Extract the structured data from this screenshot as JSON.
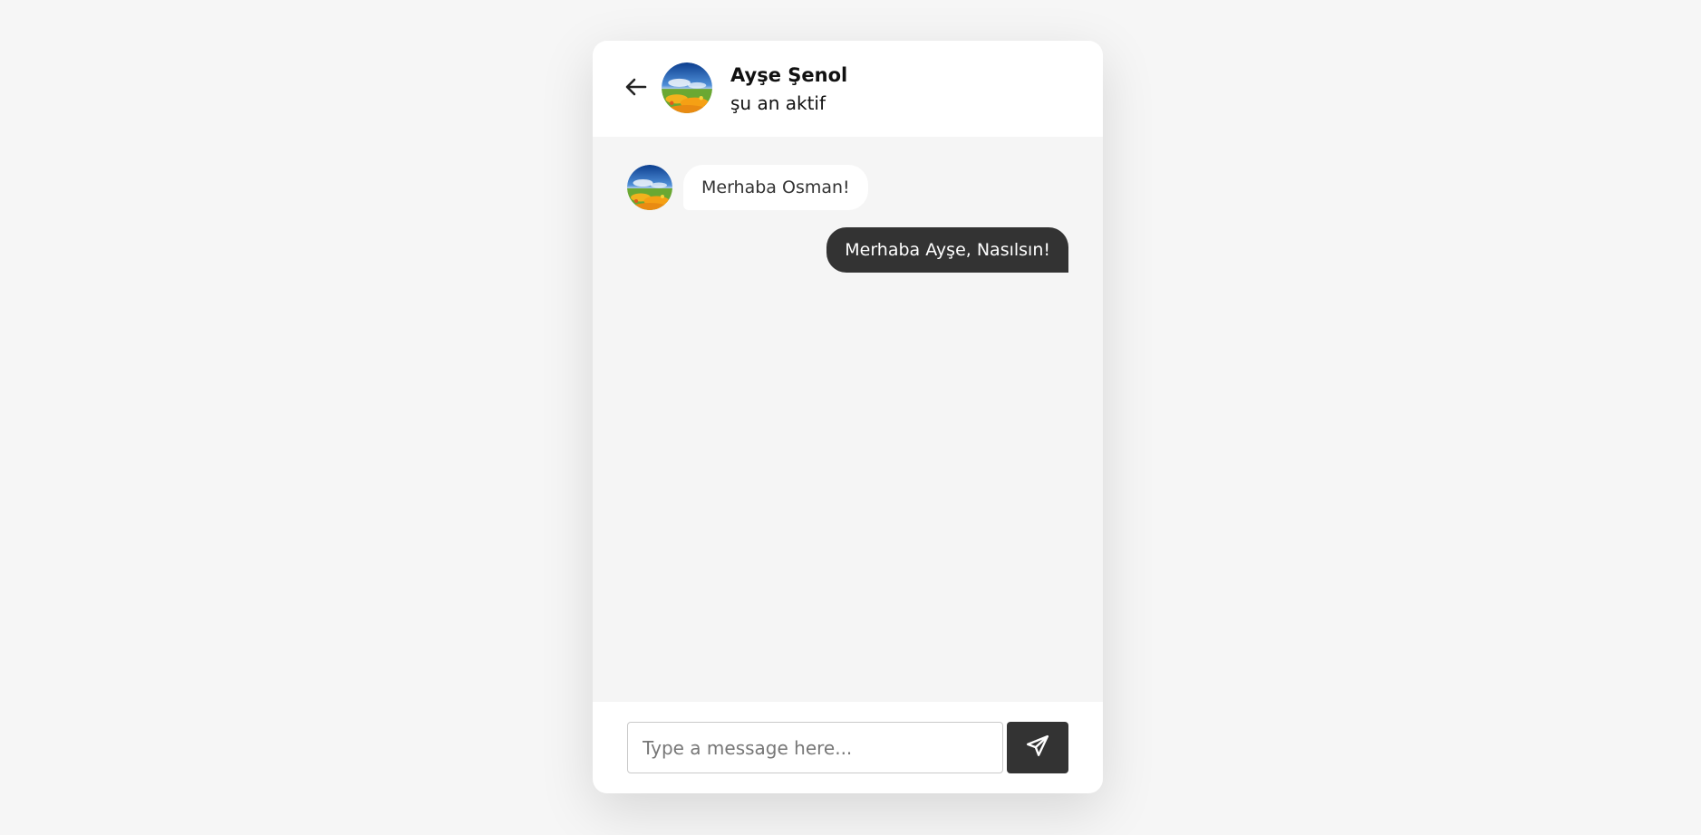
{
  "header": {
    "back_icon": "arrow-left-icon",
    "contact_name": "Ayşe Şenol",
    "contact_status": "şu an aktif"
  },
  "messages": [
    {
      "direction": "incoming",
      "text": "Merhaba Osman!"
    },
    {
      "direction": "outgoing",
      "text": "Merhaba Ayşe, Nasılsın!"
    }
  ],
  "composer": {
    "placeholder": "Type a message here...",
    "value": "",
    "send_icon": "paper-plane-icon"
  },
  "colors": {
    "page_background": "#f6f6f6",
    "chat_background": "#f5f5f5",
    "outgoing_bubble": "#333333",
    "incoming_bubble": "#ffffff",
    "send_button": "#333333"
  }
}
